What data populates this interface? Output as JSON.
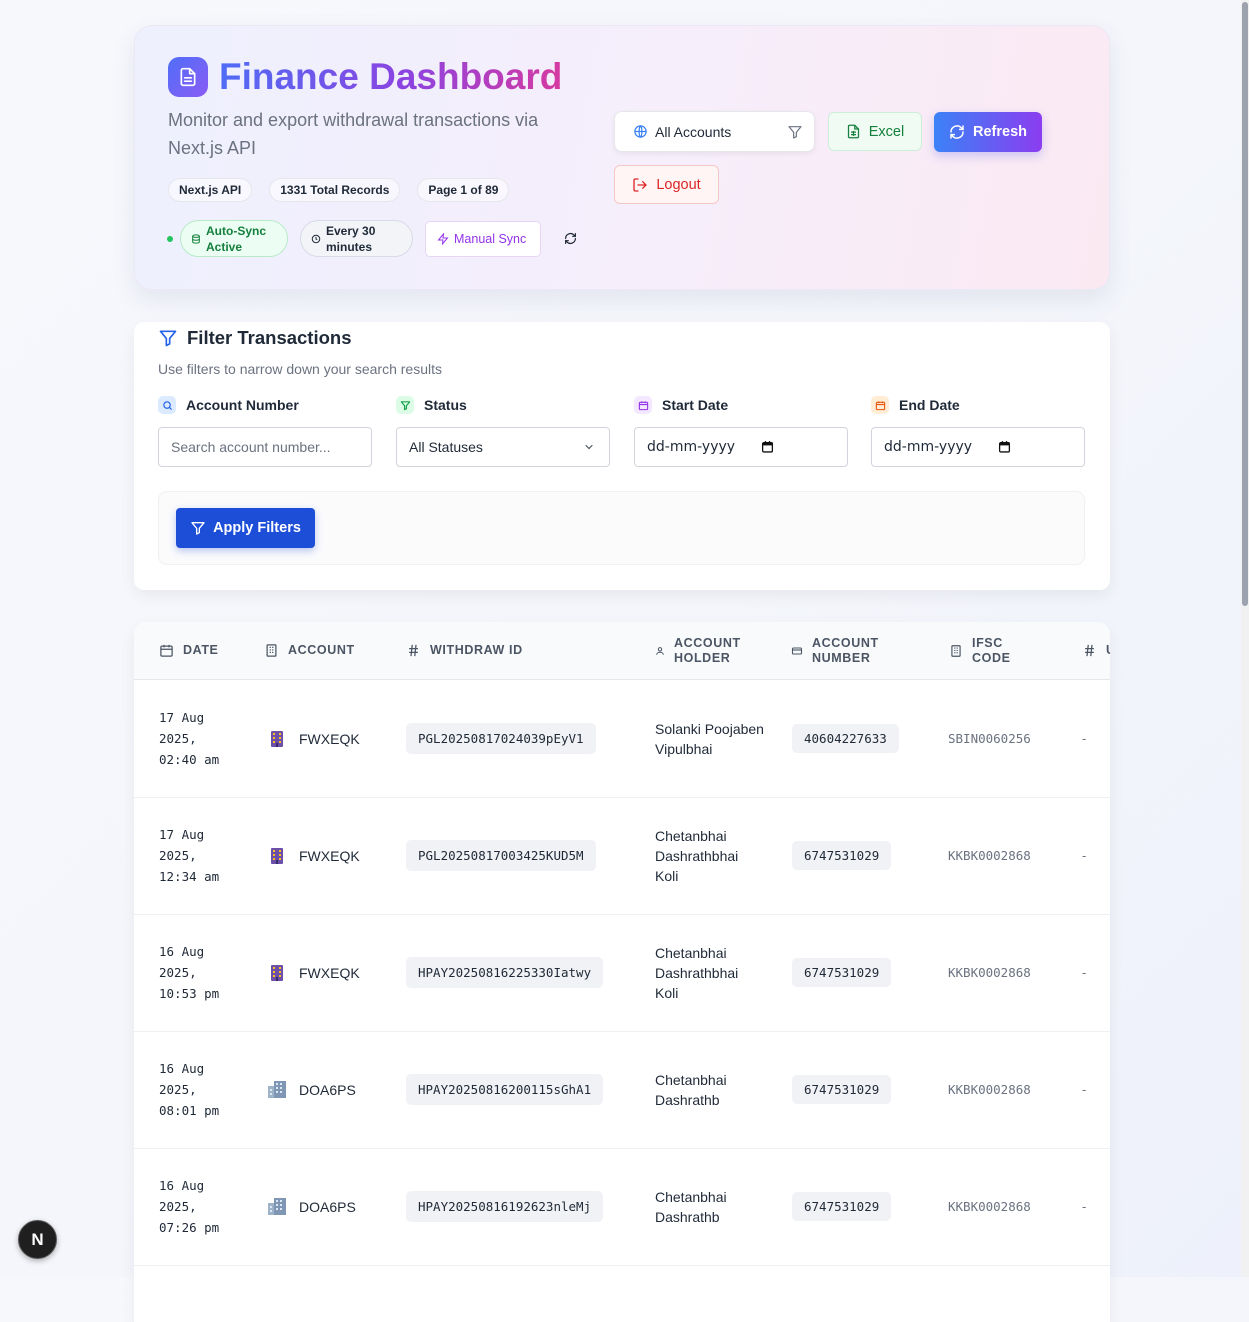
{
  "header": {
    "title": "Finance Dashboard",
    "subtitle": "Monitor and export withdrawal transactions via Next.js API",
    "chips": [
      "Next.js API",
      "1331 Total Records",
      "Page 1 of 89"
    ],
    "auto_sync": "Auto-Sync Active",
    "interval": "Every 30 minutes",
    "manual_sync": "Manual Sync",
    "account_select": "All Accounts",
    "excel_label": "Excel",
    "refresh_label": "Refresh",
    "logout_label": "Logout"
  },
  "filters": {
    "title": "Filter Transactions",
    "subtitle": "Use filters to narrow down your search results",
    "account_label": "Account Number",
    "account_placeholder": "Search account number...",
    "status_label": "Status",
    "status_value": "All Statuses",
    "start_label": "Start Date",
    "start_value": "dd-mm-yyyy",
    "end_label": "End Date",
    "end_value": "dd-mm-yyyy",
    "apply_label": "Apply Filters"
  },
  "table": {
    "headers": {
      "date": "DATE",
      "account": "ACCOUNT",
      "withdraw_id": "WITHDRAW ID",
      "holder_1": "ACCOUNT",
      "holder_2": "HOLDER",
      "number_1": "ACCOUNT",
      "number_2": "NUMBER",
      "ifsc_1": "IFSC",
      "ifsc_2": "CODE",
      "next": "U"
    },
    "rows": [
      {
        "date": "17 Aug 2025, 02:40 am",
        "account": "FWXEQK",
        "withdraw_id": "PGL20250817024039pEyV1",
        "holder": "Solanki Poojaben Vipulbhai",
        "account_number": "40604227633",
        "ifsc": "SBIN0060256",
        "extra": "-"
      },
      {
        "date": "17 Aug 2025, 12:34 am",
        "account": "FWXEQK",
        "withdraw_id": "PGL20250817003425KUD5M",
        "holder": "Chetanbhai Dashrathbhai Koli",
        "account_number": "6747531029",
        "ifsc": "KKBK0002868",
        "extra": "-"
      },
      {
        "date": "16 Aug 2025, 10:53 pm",
        "account": "FWXEQK",
        "withdraw_id": "HPAY20250816225330Iatwy",
        "holder": "Chetanbhai Dashrathbhai Koli",
        "account_number": "6747531029",
        "ifsc": "KKBK0002868",
        "extra": "-"
      },
      {
        "date": "16 Aug 2025, 08:01 pm",
        "account": "DOA6PS",
        "withdraw_id": "HPAY20250816200115sGhA1",
        "holder": "Chetanbhai Dashrathb",
        "account_number": "6747531029",
        "ifsc": "KKBK0002868",
        "extra": "-"
      },
      {
        "date": "16 Aug 2025, 07:26 pm",
        "account": "DOA6PS",
        "withdraw_id": "HPAY20250816192623nleMj",
        "holder": "Chetanbhai Dashrathb",
        "account_number": "6747531029",
        "ifsc": "KKBK0002868",
        "extra": "-"
      }
    ]
  },
  "nextjs_badge": "N"
}
